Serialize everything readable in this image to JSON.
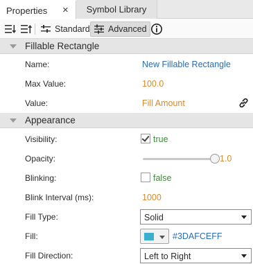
{
  "tabs": [
    {
      "label": "Properties",
      "active": true,
      "close": "×"
    },
    {
      "label": "Symbol Library",
      "active": false
    }
  ],
  "toolbar": {
    "sort_icon": "sort-down-icon",
    "sort_alt_icon": "sort-alt-icon",
    "standard_label": "Standard",
    "advanced_label": "Advanced",
    "advanced_active": true,
    "info_icon": "info-icon"
  },
  "sections": [
    {
      "title": "Fillable Rectangle",
      "rows": [
        {
          "label": "Name:",
          "value": "New Fillable Rectangle"
        },
        {
          "label": "Max Value:",
          "value": "100.0"
        },
        {
          "label": "Value:",
          "value": "Fill Amount",
          "icon": "link-icon"
        }
      ]
    },
    {
      "title": "Appearance",
      "rows": [
        {
          "label": "Visibility:",
          "checked": true,
          "value": "true"
        },
        {
          "label": "Opacity:",
          "slider_fraction": 1.0,
          "value": "1.0"
        },
        {
          "label": "Blinking:",
          "checked": false,
          "value": "false"
        },
        {
          "label": "Blink Interval (ms):",
          "value": "1000"
        },
        {
          "label": "Fill Type:",
          "value": "Solid"
        },
        {
          "label": "Fill:",
          "value": "#3DAFCEFF",
          "swatch": "#3DAFCE"
        },
        {
          "label": "Fill Direction:",
          "value": "Left to Right"
        }
      ]
    }
  ],
  "colors": {
    "value_blue": "#2a6cae",
    "value_orange": "#d68a2e",
    "value_green": "#3e8a3e",
    "section_bg": "#e5e5e5"
  }
}
